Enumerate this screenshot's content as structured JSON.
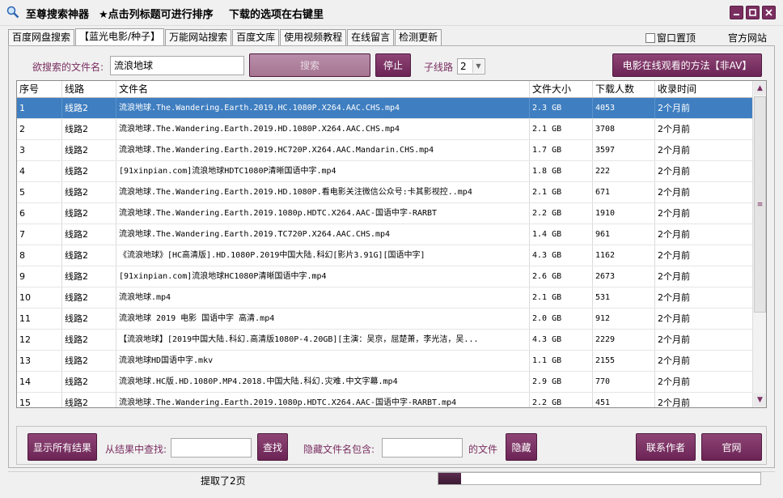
{
  "titlebar": {
    "app_title": "至尊搜索神器",
    "hint_sort": "★点击列标题可进行排序",
    "hint_download": "下载的选项在右键里"
  },
  "tabs": [
    {
      "label": "百度网盘搜索",
      "active": false
    },
    {
      "label": "【蓝光电影/种子】",
      "active": true
    },
    {
      "label": "万能网站搜索",
      "active": false
    },
    {
      "label": "百度文库",
      "active": false
    },
    {
      "label": "使用视频教程",
      "active": false
    },
    {
      "label": "在线留言",
      "active": false
    },
    {
      "label": "检测更新",
      "active": false
    }
  ],
  "top_right": {
    "pin_label": "窗口置顶",
    "official_site": "官方网站"
  },
  "search": {
    "label": "欲搜索的文件名:",
    "value": "流浪地球",
    "search_button": "搜索",
    "stop_button": "停止",
    "subline_label": "子线路",
    "subline_value": "2",
    "online_method_button": "电影在线观看的方法【非AV】"
  },
  "table": {
    "columns": [
      "序号",
      "线路",
      "文件名",
      "文件大小",
      "下载人数",
      "收录时间"
    ],
    "rows": [
      [
        "1",
        "线路2",
        "流浪地球.The.Wandering.Earth.2019.HC.1080P.X264.AAC.CHS.mp4",
        "2.3  GB",
        "4053",
        "2个月前"
      ],
      [
        "2",
        "线路2",
        "流浪地球.The.Wandering.Earth.2019.HD.1080P.X264.AAC.CHS.mp4",
        "2.1  GB",
        "3708",
        "2个月前"
      ],
      [
        "3",
        "线路2",
        "流浪地球.The.Wandering.Earth.2019.HC720P.X264.AAC.Mandarin.CHS.mp4",
        "1.7  GB",
        "3597",
        "2个月前"
      ],
      [
        "4",
        "线路2",
        "[91xinpian.com]流浪地球HDTC1080P清晰国语中字.mp4",
        "1.8  GB",
        "222",
        "2个月前"
      ],
      [
        "5",
        "线路2",
        "流浪地球.The.Wandering.Earth.2019.HD.1080P.看电影关注微信公众号:卡其影视控..mp4",
        "2.1  GB",
        "671",
        "2个月前"
      ],
      [
        "6",
        "线路2",
        "流浪地球.The.Wandering.Earth.2019.1080p.HDTC.X264.AAC-国语中字-RARBT",
        "2.2  GB",
        "1910",
        "2个月前"
      ],
      [
        "7",
        "线路2",
        "流浪地球.The.Wandering.Earth.2019.TC720P.X264.AAC.CHS.mp4",
        "1.4  GB",
        "961",
        "2个月前"
      ],
      [
        "8",
        "线路2",
        "《流浪地球》[HC高清版].HD.1080P.2019中国大陆.科幻[影片3.91G][国语中字]",
        "4.3  GB",
        "1162",
        "2个月前"
      ],
      [
        "9",
        "线路2",
        "[91xinpian.com]流浪地球HC1080P清晰国语中字.mp4",
        "2.6  GB",
        "2673",
        "2个月前"
      ],
      [
        "10",
        "线路2",
        "流浪地球.mp4",
        "2.1  GB",
        "531",
        "2个月前"
      ],
      [
        "11",
        "线路2",
        "流浪地球 2019 电影 国语中字 高清.mp4",
        "2.0  GB",
        "912",
        "2个月前"
      ],
      [
        "12",
        "线路2",
        "【流浪地球】[2019中国大陆.科幻.高清版1080P-4.20GB][主演：吴京，屈楚萧，李光洁，吴...",
        "4.3  GB",
        "2229",
        "2个月前"
      ],
      [
        "13",
        "线路2",
        "流浪地球HD国语中字.mkv",
        "1.1  GB",
        "2155",
        "2个月前"
      ],
      [
        "14",
        "线路2",
        "流浪地球.HC版.HD.1080P.MP4.2018.中国大陆.科幻.灾难.中文字幕.mp4",
        "2.9  GB",
        "770",
        "2个月前"
      ],
      [
        "15",
        "线路2",
        "流浪地球.The.Wandering.Earth.2019.1080p.HDTC.X264.AAC-国语中字-RARBT.mp4",
        "2.2  GB",
        "451",
        "2个月前"
      ]
    ]
  },
  "bottom": {
    "show_all_button": "显示所有结果",
    "find_label": "从结果中查找:",
    "find_value": "",
    "find_button": "查找",
    "hide_label": "隐藏文件名包含:",
    "hide_value": "",
    "hide_suffix": "的文件",
    "hide_button": "隐藏",
    "contact_button": "联系作者",
    "website_button": "官网"
  },
  "status": {
    "text": "提取了2页",
    "progress": 0.07
  },
  "colors": {
    "accent": "#7a2e60",
    "selection": "#3f7ec0"
  }
}
